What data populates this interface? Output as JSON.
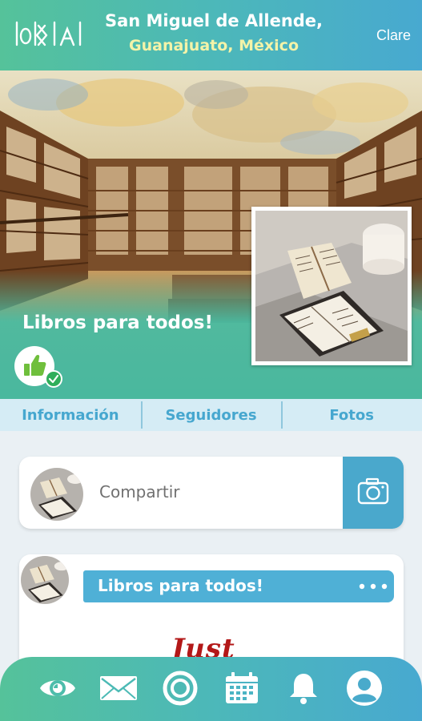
{
  "header": {
    "logo_text": "lokkal",
    "location_line1": "San Miguel de Allende,",
    "location_line2": "Guanajuato, México",
    "user_name": "Clare"
  },
  "profile": {
    "page_title": "Libros para todos!"
  },
  "tabs": [
    {
      "label": "Información"
    },
    {
      "label": "Seguidores"
    },
    {
      "label": "Fotos"
    }
  ],
  "share": {
    "placeholder": "Compartir"
  },
  "post": {
    "title": "Libros para todos!",
    "preview_text": "Just"
  },
  "bottom_nav": {
    "items": [
      {
        "icon": "eye-icon"
      },
      {
        "icon": "mail-icon"
      },
      {
        "icon": "ring-icon"
      },
      {
        "icon": "calendar-icon"
      },
      {
        "icon": "bell-icon"
      },
      {
        "icon": "profile-icon"
      }
    ]
  },
  "colors": {
    "header_gradient_start": "#55c29a",
    "header_gradient_end": "#48a9d0",
    "accent_blue": "#4aa8cc",
    "location_yellow": "#f4f3a8",
    "verified_green": "#2fae5a"
  }
}
